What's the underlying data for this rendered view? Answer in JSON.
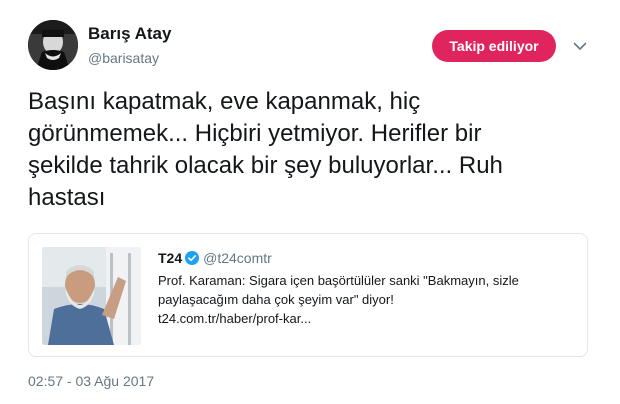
{
  "author": {
    "display_name": "Barış Atay",
    "handle": "@barisatay"
  },
  "follow_button": {
    "label": "Takip ediliyor",
    "color": "#e0245e"
  },
  "tweet": {
    "lines": [
      "Başını kapatmak, eve kapanmak, hiç",
      "görünmemek... Hiçbiri yetmiyor. Herifler bir",
      "şekilde tahrik olacak bir şey buluyorlar... Ruh",
      "hastası"
    ]
  },
  "quoted": {
    "name": "T24",
    "handle": "@t24comtr",
    "verified_icon": "verified-badge-icon",
    "verified_color": "#1da1f2",
    "lines": [
      "Prof. Karaman: Sigara içen başörtülüler sanki \"Bakmayın, sizle",
      "paylaşacağım daha çok şeyim var\" diyor!",
      "t24.com.tr/haber/prof-kar..."
    ]
  },
  "timestamp": "02:57 - 03 Ağu 2017",
  "colors": {
    "text": "#14171a",
    "muted": "#657786",
    "border": "#e1e8ed"
  }
}
